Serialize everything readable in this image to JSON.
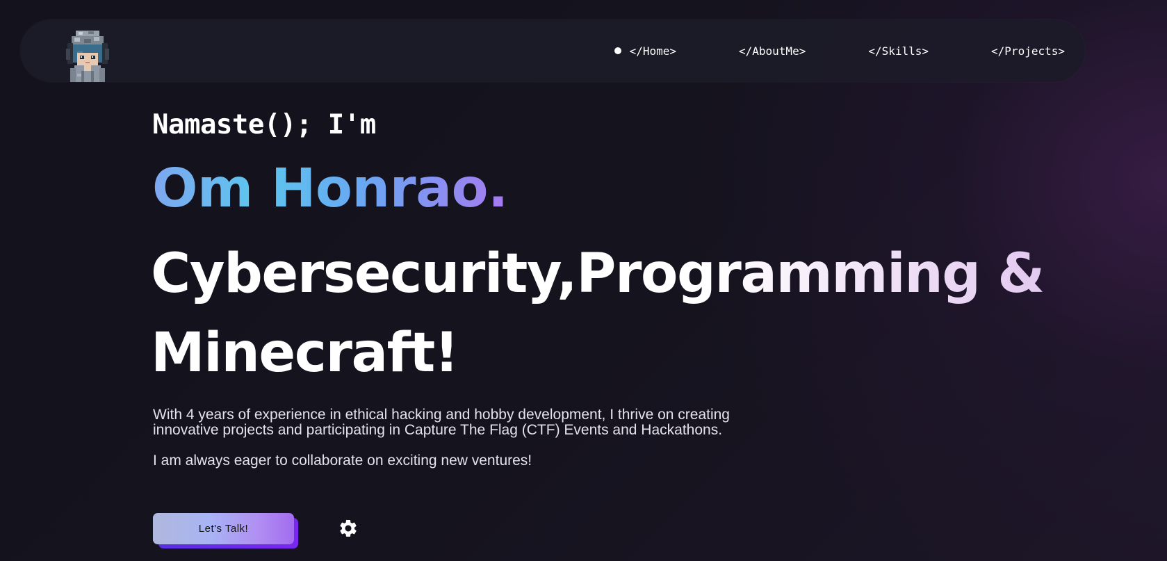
{
  "nav": {
    "avatar_alt": "pixel-avatar",
    "links": [
      {
        "label": "</Home>",
        "active": true
      },
      {
        "label": "</AboutMe>",
        "active": false
      },
      {
        "label": "</Skills>",
        "active": false
      },
      {
        "label": "</Projects>",
        "active": false
      }
    ]
  },
  "hero": {
    "greeting": "Namaste(); I'm",
    "name": "Om Honrao.",
    "tagline_line1": "Cybersecurity,Programming &",
    "tagline_line2": "Minecraft!",
    "bio_paragraph1": "With 4 years of experience in ethical hacking and hobby development, I thrive on creating innovative projects and participating in Capture The Flag (CTF) Events and Hackathons.",
    "bio_paragraph2": "I am always eager to collaborate on exciting new ventures!"
  },
  "cta": {
    "label": "Let's Talk!"
  },
  "icons": {
    "settings": "gear-icon"
  },
  "colors": {
    "background": "#13111b",
    "navbar": "#1c1b28",
    "name_gradient": [
      "#7ea7f0",
      "#5cc6ee",
      "#a77af0"
    ],
    "cta_gradient": [
      "#b0b8dc",
      "#a36cf0"
    ],
    "cta_shadow": "#6a2ae8"
  }
}
